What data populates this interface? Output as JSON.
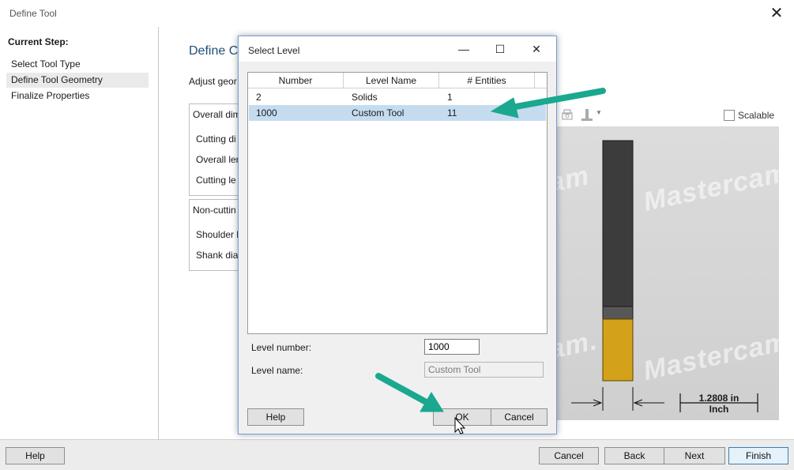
{
  "window": {
    "title": "Define Tool",
    "close_glyph": "✕"
  },
  "sidebar": {
    "heading": "Current Step:",
    "steps": [
      {
        "label": "Select Tool Type",
        "active": false
      },
      {
        "label": "Define Tool Geometry",
        "active": true
      },
      {
        "label": "Finalize Properties",
        "active": false
      }
    ]
  },
  "main": {
    "heading": "Define C",
    "instruction": "Adjust geor",
    "group1": {
      "title": "Overall dim",
      "rows": [
        "Cutting di",
        "Overall ler",
        "Cutting le"
      ]
    },
    "group2": {
      "title": "Non-cuttin",
      "rows": [
        "Shoulder l",
        "Shank dia"
      ]
    }
  },
  "preview": {
    "scalable_label": "Scalable",
    "scalable_checked": false,
    "watermark": "Mastercam",
    "watermark_partial_1": "am",
    "watermark_partial_2": "am.",
    "dimension_value": "1.2808 in",
    "dimension_unit": "Inch",
    "icons": [
      "print-icon",
      "tool-holder-icon",
      "dropdown-arrow-icon"
    ]
  },
  "footer": {
    "help": "Help",
    "cancel": "Cancel",
    "back": "Back",
    "next": "Next",
    "finish": "Finish"
  },
  "dialog": {
    "title": "Select Level",
    "minimize_glyph": "—",
    "maximize_glyph": "☐",
    "close_glyph": "✕",
    "columns": [
      "Number",
      "Level Name",
      "# Entities"
    ],
    "rows": [
      {
        "number": "2",
        "name": "Solids",
        "entities": "1",
        "selected": false
      },
      {
        "number": "1000",
        "name": "Custom Tool",
        "entities": "11",
        "selected": true
      }
    ],
    "level_number_label": "Level number:",
    "level_number_value": "1000",
    "level_name_label": "Level name:",
    "level_name_value": "Custom Tool",
    "help": "Help",
    "ok": "OK",
    "cancel": "Cancel"
  },
  "colors": {
    "annotation_arrow": "#1aa88f",
    "selection": "#c5dcf0",
    "tool_cutter": "#d3a21a",
    "tool_shank": "#3a3a3a"
  }
}
